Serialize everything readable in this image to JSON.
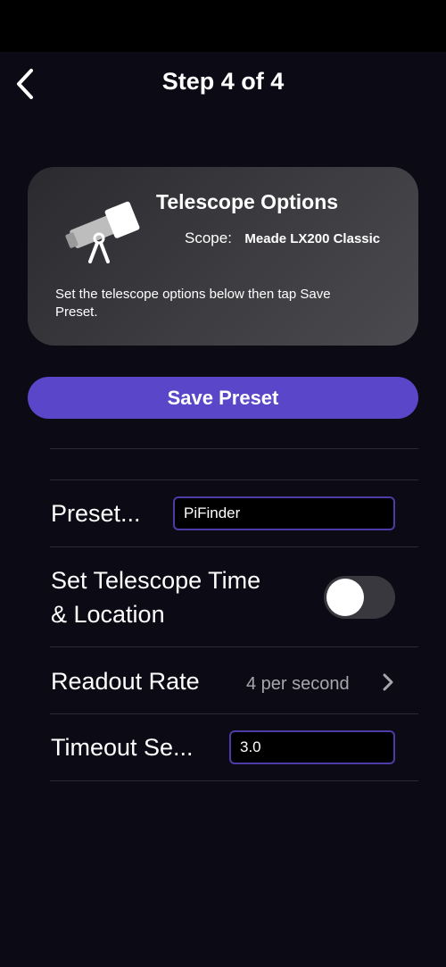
{
  "nav": {
    "title": "Step 4 of 4",
    "back_icon": "chevron-left-icon"
  },
  "card": {
    "icon": "telescope-icon",
    "title": "Telescope Options",
    "scope_label": "Scope:",
    "scope_value": "Meade LX200 Classic",
    "description": "Set the telescope options below then tap Save Preset."
  },
  "save_button": {
    "label": "Save Preset",
    "color": "#5a46c8"
  },
  "settings": {
    "preset": {
      "label": "Preset...",
      "value": "PiFinder"
    },
    "time_location": {
      "label_line1": "Set Telescope Time",
      "label_line2": "& Location",
      "enabled": false
    },
    "readout_rate": {
      "label": "Readout Rate",
      "value": "4 per second"
    },
    "timeout": {
      "label": "Timeout Se...",
      "value": "3.0"
    }
  }
}
